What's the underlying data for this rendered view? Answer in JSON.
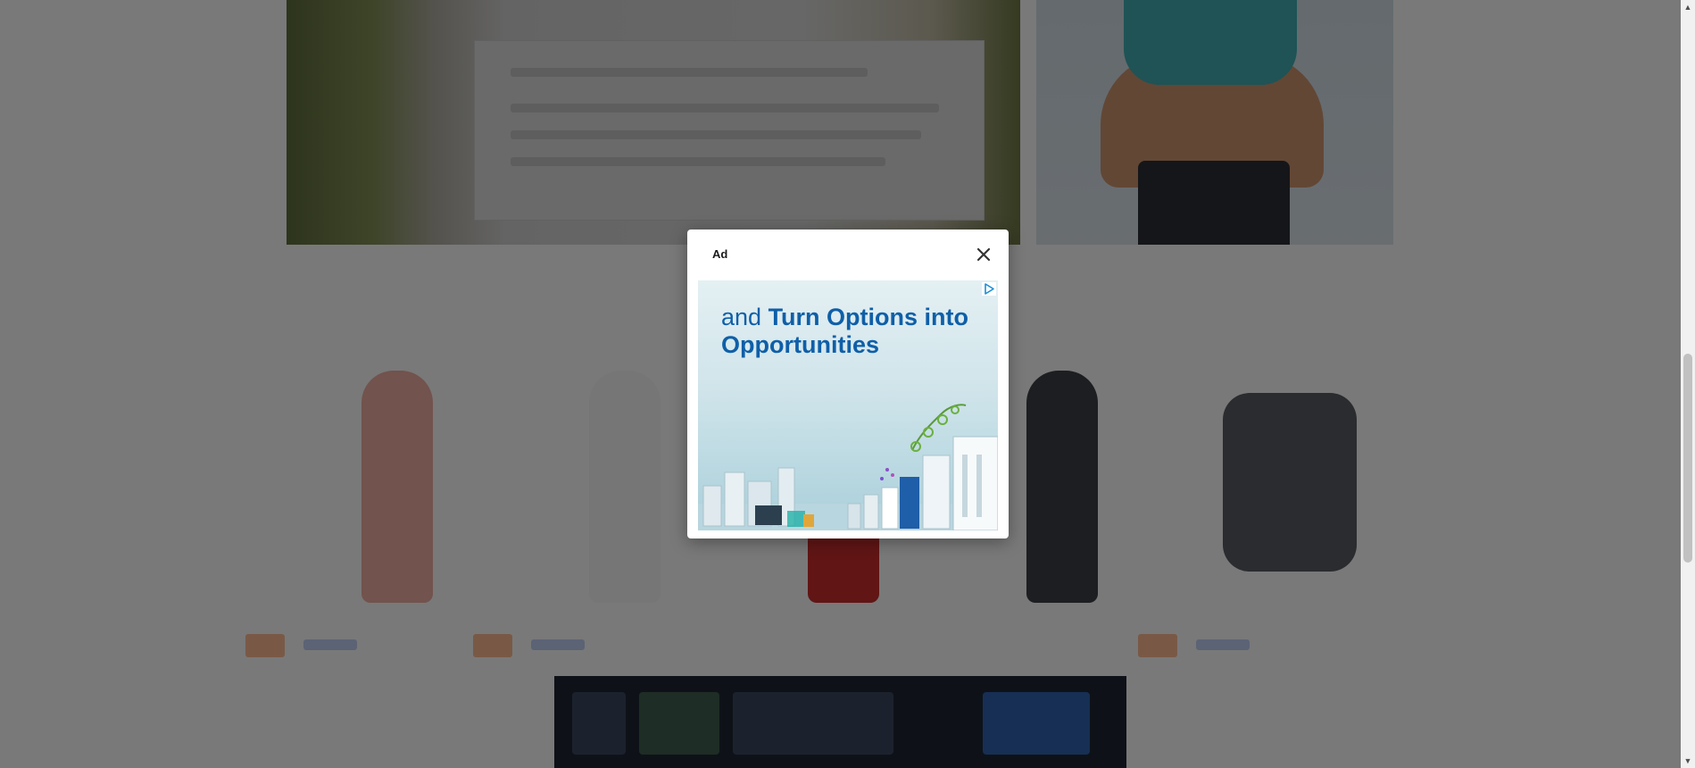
{
  "ad_modal": {
    "title": "Ad",
    "close_icon": "close-icon",
    "headline_normal": "and ",
    "headline_bold": "Turn Options into Opportunities",
    "adchoices_icon": "adchoices-icon"
  },
  "colors": {
    "overlay": "#000000",
    "headline": "#0f5fa8",
    "modal_bg": "#ffffff"
  }
}
